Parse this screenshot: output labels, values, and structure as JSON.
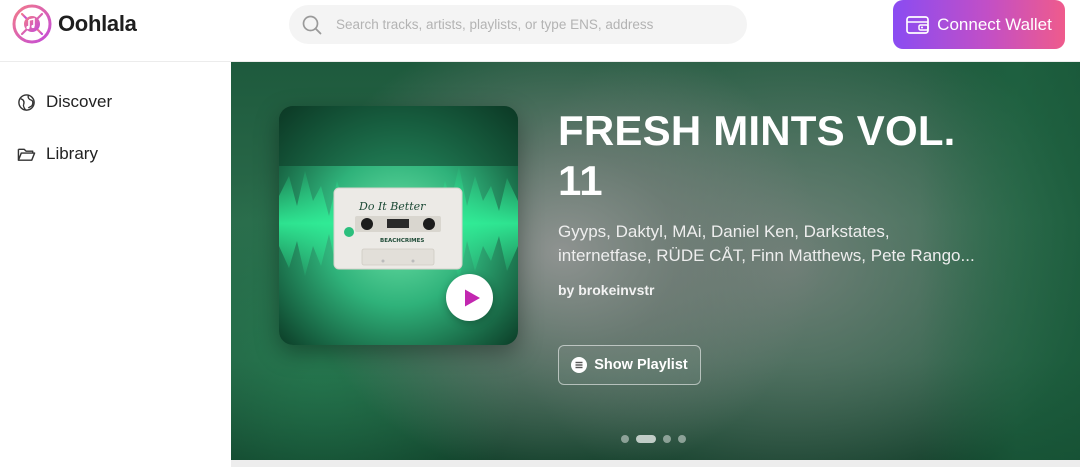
{
  "app": {
    "name": "Oohlala",
    "logo_icon": "oohlala-logo-icon"
  },
  "search": {
    "icon": "search-icon",
    "placeholder": "Search tracks, artists, playlists, or type ENS, address"
  },
  "header": {
    "connect_label": "Connect Wallet",
    "connect_icon": "wallet-icon"
  },
  "sidebar": {
    "items": [
      {
        "label": "Discover",
        "icon": "globe-icon"
      },
      {
        "label": "Library",
        "icon": "folder-icon"
      }
    ]
  },
  "featured": {
    "title": "FRESH MINTS VOL. 11",
    "artists": "Gyyps, Daktyl, MAi, Daniel Ken, Darkstates, internetfase, RÜDE CÅT, Finn Matthews, Pete Rango...",
    "by_prefix": "by",
    "curator": "brokeinvstr",
    "show_playlist_label": "Show Playlist",
    "play_icon": "play-icon",
    "cover_art": {
      "cassette_title": "Do It Better",
      "cassette_label": "BEACHCRIMES"
    },
    "carousel": {
      "count": 4,
      "active_index": 1
    }
  },
  "colors": {
    "accent_gradient": [
      "#8a4cf2",
      "#c24fc6",
      "#ef5b8c"
    ],
    "play_icon": "#c227b0",
    "hero_green": "#1e5a3d"
  }
}
